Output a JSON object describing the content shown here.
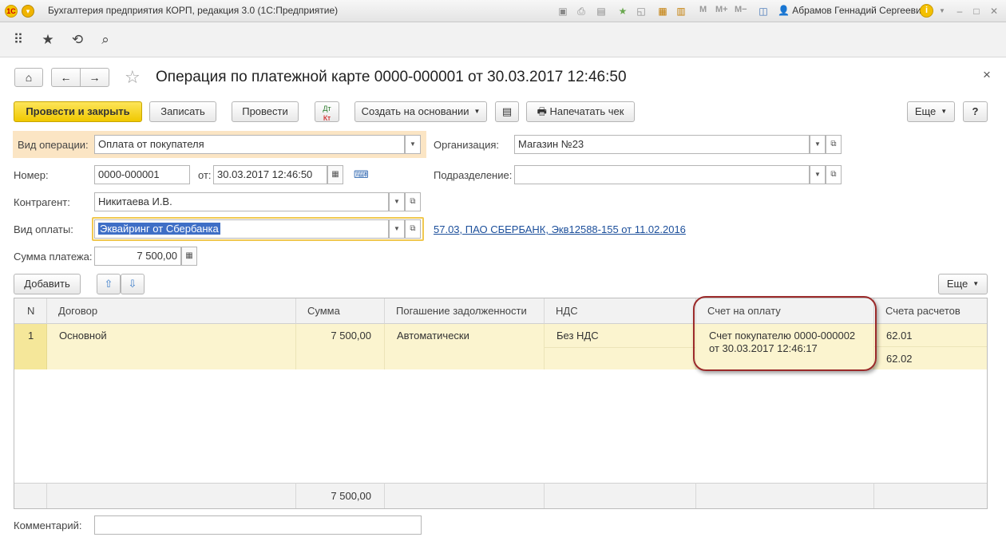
{
  "window": {
    "title": "Бухгалтерия предприятия КОРП, редакция 3.0  (1С:Предприятие)",
    "user": "Абрамов Геннадий Сергеевич",
    "memory_buttons": [
      "M",
      "M+",
      "M−"
    ],
    "info_icon": "i"
  },
  "form": {
    "title": "Операция по платежной карте 0000-000001 от 30.03.2017 12:46:50",
    "close": "×"
  },
  "buttons": {
    "post_close": "Провести и закрыть",
    "save": "Записать",
    "post": "Провести",
    "create_based": "Создать на основании",
    "print_receipt": "Напечатать чек",
    "more": "Еще",
    "help": "?",
    "add": "Добавить",
    "table_more": "Еще"
  },
  "fields": {
    "operation_type_label": "Вид операции:",
    "operation_type": "Оплата от покупателя",
    "number_label": "Номер:",
    "number": "0000-000001",
    "date_label": "от:",
    "date": "30.03.2017 12:46:50",
    "counterparty_label": "Контрагент:",
    "counterparty": "Никитаева И.В.",
    "payment_type_label": "Вид оплаты:",
    "payment_type": "Эквайринг от Сбербанка",
    "payment_link": "57.03, ПАО СБЕРБАНК, Экв12588-155 от 11.02.2016",
    "amount_label": "Сумма платежа:",
    "amount": "7 500,00",
    "organization_label": "Организация:",
    "organization": "Магазин №23",
    "department_label": "Подразделение:",
    "department": "",
    "comment_label": "Комментарий:",
    "comment": ""
  },
  "table": {
    "columns": [
      "N",
      "Договор",
      "Сумма",
      "Погашение задолженности",
      "НДС",
      "Счет на оплату",
      "Счета расчетов"
    ],
    "rows": [
      {
        "n": "1",
        "contract": "Основной",
        "amount": "7 500,00",
        "repayment": "Автоматически",
        "vat": "Без НДС",
        "invoice_line1": "Счет покупателю 0000-000002",
        "invoice_line2": "от 30.03.2017 12:46:17",
        "account1": "62.01",
        "account2": "62.02"
      }
    ],
    "total_amount": "7 500,00"
  },
  "colors": {
    "primary_button": "#f0c800",
    "selection": "#3f6fc6",
    "row_highlight": "#fbf4cf",
    "annotation_circle": "#9b2a2a",
    "link": "#1c4f9b"
  }
}
